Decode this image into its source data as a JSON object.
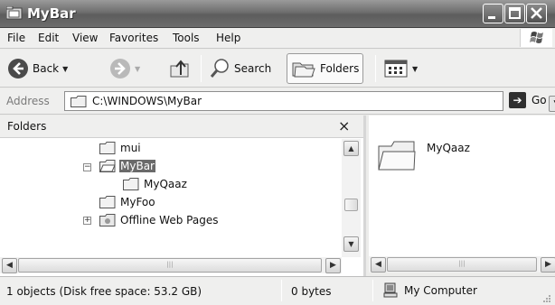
{
  "window": {
    "title": "MyBar"
  },
  "menu": {
    "items": [
      "File",
      "Edit",
      "View",
      "Favorites",
      "Tools",
      "Help"
    ]
  },
  "toolbar": {
    "back_label": "Back",
    "search_label": "Search",
    "folders_label": "Folders"
  },
  "address": {
    "label": "Address",
    "value": "C:\\WINDOWS\\MyBar",
    "go_label": "Go"
  },
  "folders_pane": {
    "header": "Folders",
    "close_glyph": "×",
    "tree": [
      {
        "label": "mui",
        "selected": false
      },
      {
        "label": "MyBar",
        "selected": true,
        "expanded": true
      },
      {
        "label": "MyQaaz",
        "selected": false
      },
      {
        "label": "MyFoo",
        "selected": false
      },
      {
        "label": "Offline Web Pages",
        "selected": false
      }
    ],
    "expander_symbol": "⊟"
  },
  "contents": {
    "items": [
      {
        "name": "MyQaaz",
        "icon": "folder-icon"
      }
    ]
  },
  "status": {
    "objects": "1 objects (Disk free space: 53.2 GB)",
    "size": "0 bytes",
    "location": "My Computer"
  },
  "colors": {
    "titlebar": "#6e6e6e",
    "selection": "#6a6a6a",
    "chrome": "#efefee"
  }
}
